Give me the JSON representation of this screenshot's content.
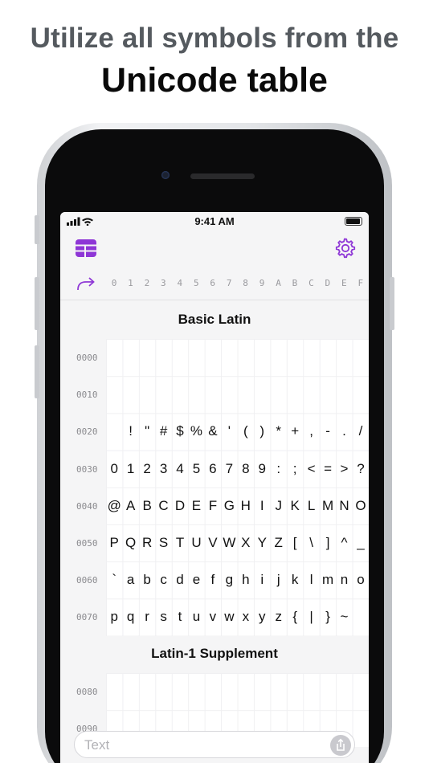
{
  "headline": {
    "line1": "Utilize all symbols from the",
    "line2": "Unicode table"
  },
  "status_bar": {
    "time": "9:41 AM"
  },
  "toolbar": {
    "left_icon": "table-icon",
    "right_icon": "gear-icon",
    "accent": "#8e36d6"
  },
  "column_headers": [
    "0",
    "1",
    "2",
    "3",
    "4",
    "5",
    "6",
    "7",
    "8",
    "9",
    "A",
    "B",
    "C",
    "D",
    "E",
    "F"
  ],
  "sections": [
    {
      "title": "Basic Latin",
      "rows": [
        {
          "label": "0000",
          "chars": [
            "",
            "",
            "",
            "",
            "",
            "",
            "",
            "",
            "",
            "",
            "",
            "",
            "",
            "",
            "",
            ""
          ]
        },
        {
          "label": "0010",
          "chars": [
            "",
            "",
            "",
            "",
            "",
            "",
            "",
            "",
            "",
            "",
            "",
            "",
            "",
            "",
            "",
            ""
          ]
        },
        {
          "label": "0020",
          "chars": [
            "",
            " !",
            "\"",
            "#",
            "$",
            "%",
            "&",
            "'",
            "(",
            ")",
            "*",
            "+",
            ",",
            "-",
            ".",
            "/"
          ]
        },
        {
          "label": "0030",
          "chars": [
            "0",
            "1",
            "2",
            "3",
            "4",
            "5",
            "6",
            "7",
            "8",
            "9",
            ":",
            ";",
            "<",
            "=",
            ">",
            "?"
          ]
        },
        {
          "label": "0040",
          "chars": [
            "@",
            "A",
            "B",
            "C",
            "D",
            "E",
            "F",
            "G",
            "H",
            "I",
            "J",
            "K",
            "L",
            "M",
            "N",
            "O"
          ]
        },
        {
          "label": "0050",
          "chars": [
            "P",
            "Q",
            "R",
            "S",
            "T",
            "U",
            "V",
            "W",
            "X",
            "Y",
            "Z",
            "[",
            "\\",
            "]",
            "^",
            "_"
          ]
        },
        {
          "label": "0060",
          "chars": [
            "`",
            "a",
            "b",
            "c",
            "d",
            "e",
            "f",
            "g",
            "h",
            "i",
            "j",
            "k",
            "l",
            "m",
            "n",
            "o"
          ]
        },
        {
          "label": "0070",
          "chars": [
            "p",
            "q",
            "r",
            "s",
            "t",
            "u",
            "v",
            "w",
            "x",
            "y",
            "z",
            "{",
            "|",
            "}",
            "~",
            ""
          ]
        }
      ]
    },
    {
      "title": "Latin-1 Supplement",
      "rows": [
        {
          "label": "0080",
          "chars": []
        },
        {
          "label": "0090",
          "chars": []
        }
      ]
    }
  ],
  "input": {
    "placeholder": "Text",
    "value": ""
  }
}
